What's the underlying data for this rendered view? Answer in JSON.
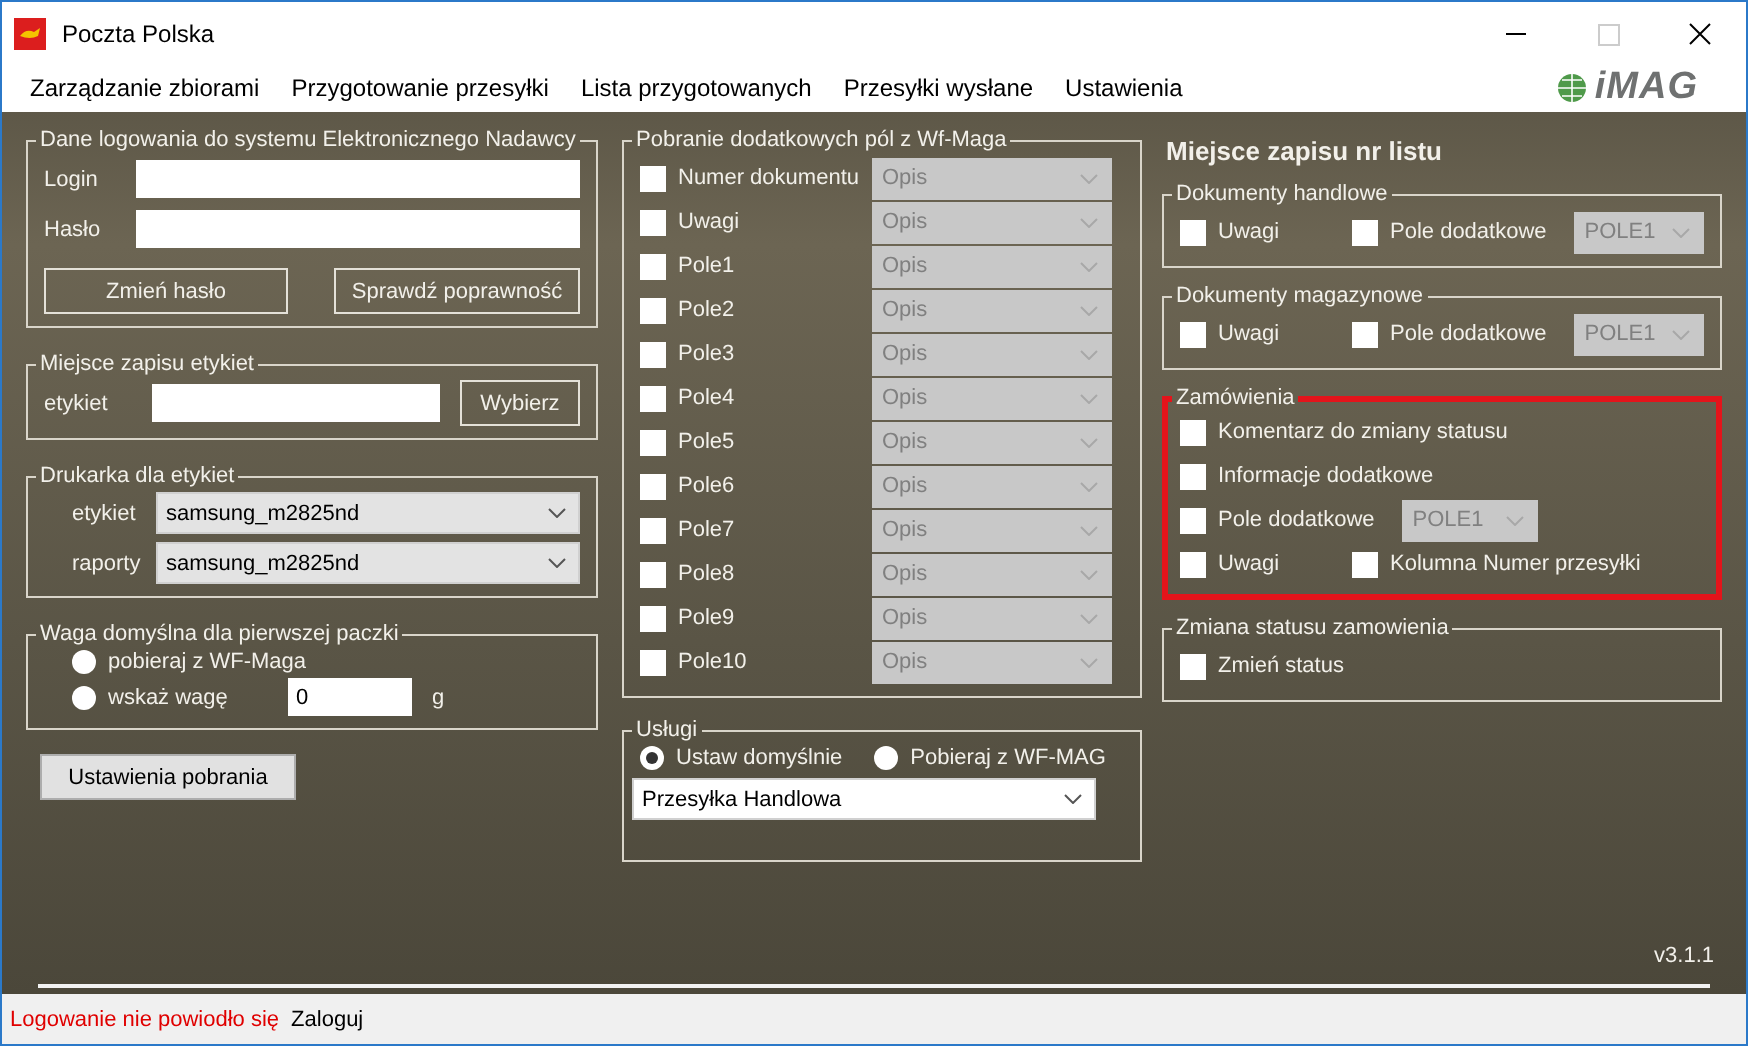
{
  "window": {
    "title": "Poczta Polska"
  },
  "menu": [
    {
      "label": "Zarządzanie zbiorami"
    },
    {
      "label": "Przygotowanie przesyłki"
    },
    {
      "label": "Lista przygotowanych"
    },
    {
      "label": "Przesyłki wysłane"
    },
    {
      "label": "Ustawienia"
    }
  ],
  "logo": {
    "text": "iMAG"
  },
  "login_group": {
    "title": "Dane logowania do systemu Elektronicznego Nadawcy",
    "fields": [
      {
        "label": "Login"
      },
      {
        "label": "Hasło"
      }
    ],
    "buttons": [
      "Zmień hasło",
      "Sprawdź poprawność"
    ]
  },
  "label_location": {
    "title": "Miejsce zapisu etykiet",
    "field_label": "etykiet",
    "button": "Wybierz"
  },
  "printer_group": {
    "title": "Drukarka dla etykiet",
    "rows": [
      {
        "label": "etykiet",
        "value": "samsung_m2825nd"
      },
      {
        "label": "raporty",
        "value": "samsung_m2825nd"
      }
    ]
  },
  "weight_group": {
    "title": "Waga domyślna dla pierwszej paczki",
    "options": [
      {
        "label": "pobieraj z WF-Maga",
        "selected": false
      },
      {
        "label": "wskaż wagę",
        "selected": false
      }
    ],
    "weight_value": "0",
    "unit": "g"
  },
  "download_settings_button": "Ustawienia pobrania",
  "fields_group": {
    "title": "Pobranie dodatkowych pól z Wf-Maga",
    "rows": [
      {
        "label": "Numer dokumentu",
        "checked": false,
        "value": "Opis",
        "disabled": true
      },
      {
        "label": "Uwagi",
        "checked": false,
        "value": "Opis",
        "disabled": true
      },
      {
        "label": "Pole1",
        "checked": false,
        "value": "Opis",
        "disabled": true
      },
      {
        "label": "Pole2",
        "checked": false,
        "value": "Opis",
        "disabled": true
      },
      {
        "label": "Pole3",
        "checked": false,
        "value": "Opis",
        "disabled": true
      },
      {
        "label": "Pole4",
        "checked": false,
        "value": "Opis",
        "disabled": true
      },
      {
        "label": "Pole5",
        "checked": false,
        "value": "Opis",
        "disabled": true
      },
      {
        "label": "Pole6",
        "checked": false,
        "value": "Opis",
        "disabled": true
      },
      {
        "label": "Pole7",
        "checked": false,
        "value": "Opis",
        "disabled": true
      },
      {
        "label": "Pole8",
        "checked": false,
        "value": "Opis",
        "disabled": true
      },
      {
        "label": "Pole9",
        "checked": false,
        "value": "Opis",
        "disabled": true
      },
      {
        "label": "Pole10",
        "checked": false,
        "value": "Opis",
        "disabled": true
      }
    ]
  },
  "services_group": {
    "title": "Usługi",
    "options": [
      {
        "label": "Ustaw domyślnie",
        "selected": true
      },
      {
        "label": "Pobieraj z WF-MAG",
        "selected": false
      }
    ],
    "value": "Przesyłka Handlowa"
  },
  "right_title": "Miejsce zapisu nr listu",
  "right_groups": [
    {
      "title": "Dokumenty handlowe",
      "highlighted": false,
      "rows": [
        [
          {
            "kind": "checkbox",
            "label": "Uwagi",
            "checked": false
          },
          {
            "kind": "checkbox",
            "label": "Pole dodatkowe",
            "checked": false
          },
          {
            "kind": "dropdown",
            "value": "POLE1",
            "disabled": true
          }
        ]
      ]
    },
    {
      "title": "Dokumenty magazynowe",
      "highlighted": false,
      "rows": [
        [
          {
            "kind": "checkbox",
            "label": "Uwagi",
            "checked": false
          },
          {
            "kind": "checkbox",
            "label": "Pole dodatkowe",
            "checked": false
          },
          {
            "kind": "dropdown",
            "value": "POLE1",
            "disabled": true
          }
        ]
      ]
    },
    {
      "title": "Zamówienia",
      "highlighted": true,
      "rows": [
        [
          {
            "kind": "checkbox",
            "label": "Komentarz do zmiany statusu",
            "checked": false
          }
        ],
        [
          {
            "kind": "checkbox",
            "label": "Informacje dodatkowe",
            "checked": false
          }
        ],
        [
          {
            "kind": "checkbox",
            "label": "Pole dodatkowe",
            "checked": false
          },
          {
            "kind": "dropdown",
            "value": "POLE1",
            "disabled": true
          }
        ],
        [
          {
            "kind": "checkbox",
            "label": "Uwagi",
            "checked": false
          },
          {
            "kind": "checkbox",
            "label": "Kolumna Numer przesyłki",
            "checked": false
          }
        ]
      ]
    },
    {
      "title": "Zmiana statusu zamowienia",
      "highlighted": false,
      "rows": [
        [
          {
            "kind": "checkbox",
            "label": "Zmień status",
            "checked": false
          }
        ]
      ]
    }
  ],
  "version": "v3.1.1",
  "status_bar": {
    "message": "Logowanie nie powiodło się",
    "action": "Zaloguj"
  }
}
